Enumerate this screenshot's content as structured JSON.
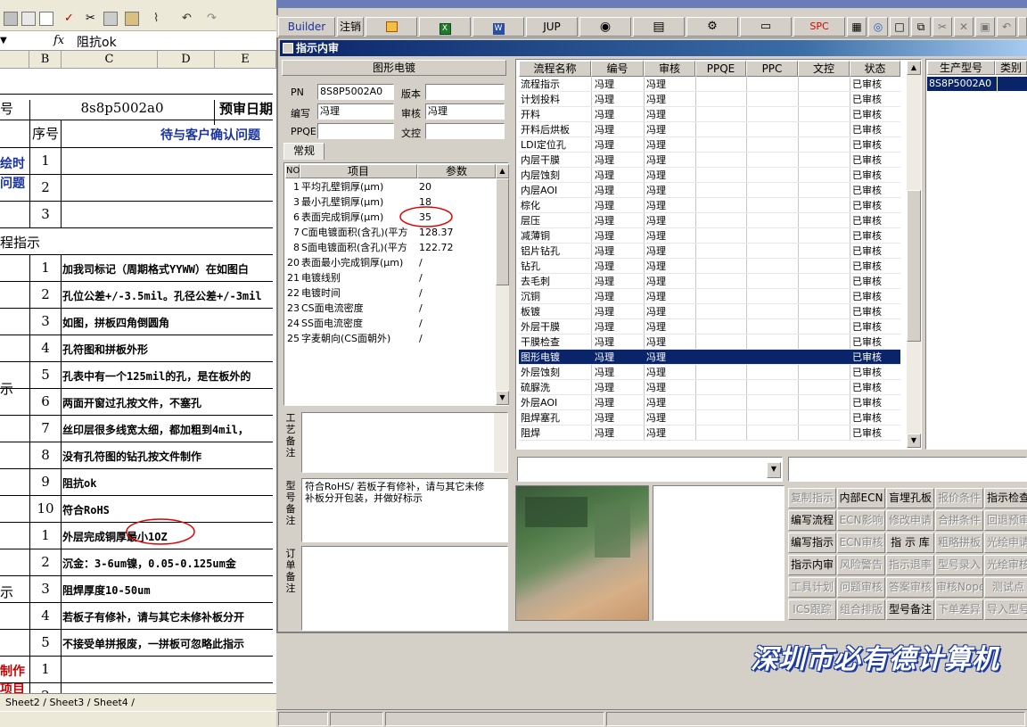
{
  "excel": {
    "formula_bar": {
      "value": "阻抗ok",
      "fx": "fx"
    },
    "columns": [
      "B",
      "C",
      "D",
      "E"
    ],
    "header_row": {
      "label": "号",
      "pn": "8s8p5002a0",
      "date_label": "预审日期"
    },
    "confirm_header": {
      "seq": "序号",
      "title": "待与客户确认问题"
    },
    "section_labels": {
      "draw_issue": "绘时问题",
      "process": "程指示",
      "left_a": "示",
      "left_b": "示",
      "make": "制作项目"
    },
    "rows_top": [
      "1",
      "2",
      "3"
    ],
    "rows_mid": [
      {
        "n": "1",
        "t": "加我司标记（周期格式YYWW）在如图白"
      },
      {
        "n": "2",
        "t": "孔位公差+/-3.5mil。孔径公差+/-3mil"
      },
      {
        "n": "3",
        "t": "如图，拼板四角倒圆角"
      },
      {
        "n": "4",
        "t": "孔符图和拼板外形"
      },
      {
        "n": "5",
        "t": "孔表中有一个125mil的孔，是在板外的"
      },
      {
        "n": "6",
        "t": "两面开窗过孔按文件，不塞孔"
      },
      {
        "n": "7",
        "t": "丝印层很多线宽太细，都加粗到4mil，"
      },
      {
        "n": "8",
        "t": "没有孔符图的钻孔按文件制作"
      },
      {
        "n": "9",
        "t": "阻抗ok"
      },
      {
        "n": "10",
        "t": "符合RoHS"
      }
    ],
    "rows_bot": [
      {
        "n": "1",
        "t": "外层完成铜厚最小1OZ"
      },
      {
        "n": "2",
        "t": "沉金：3-6um镍，0.05-0.125um金"
      },
      {
        "n": "3",
        "t": "阻焊厚度10-50um"
      },
      {
        "n": "4",
        "t": "若板子有修补，请与其它未修补板分开"
      },
      {
        "n": "5",
        "t": "不接受单拼报废，一拼板可忽略此指示"
      }
    ],
    "rows_last": [
      "1",
      "2"
    ],
    "sheet_tabs": "Sheet2 / Sheet3 / Sheet4 /"
  },
  "builder": {
    "toolbar": {
      "app_name": "Builder",
      "logout": "注销",
      "jup": "JUP",
      "spc": "SPC"
    },
    "window_title": "指示内审",
    "process_name": "图形电镀",
    "labels": {
      "pn": "PN",
      "version": "版本",
      "writer": "编写",
      "audit": "审核",
      "ppqe": "PPQE",
      "doc_ctrl": "文控",
      "tab_normal": "常规"
    },
    "values": {
      "pn": "8S8P5002A0",
      "version": "",
      "writer": "冯理",
      "audit": "冯理",
      "ppqe": "",
      "doc_ctrl": ""
    },
    "param_headers": {
      "no": "NO",
      "item": "项目",
      "param": "参数"
    },
    "params": [
      {
        "no": "1",
        "item": "平均孔壁铜厚(μm)",
        "val": "20"
      },
      {
        "no": "3",
        "item": "最小孔壁铜厚(μm)",
        "val": "18"
      },
      {
        "no": "6",
        "item": "表面完成铜厚(μm)",
        "val": "35"
      },
      {
        "no": "7",
        "item": "C面电镀面积(含孔)(平方",
        "val": "128.37"
      },
      {
        "no": "8",
        "item": "S面电镀面积(含孔)(平方",
        "val": "122.72"
      },
      {
        "no": "20",
        "item": "表面最小完成铜厚(μm)",
        "val": "/"
      },
      {
        "no": "21",
        "item": "电镀线别",
        "val": "/"
      },
      {
        "no": "22",
        "item": "电镀时间",
        "val": "/"
      },
      {
        "no": "23",
        "item": "CS面电流密度",
        "val": "/"
      },
      {
        "no": "24",
        "item": "SS面电流密度",
        "val": "/"
      },
      {
        "no": "25",
        "item": "字麦朝向(CS面朝外)",
        "val": "/"
      }
    ],
    "notes": {
      "craft_label": "工艺备注",
      "model_label": "型号备注",
      "order_label": "订单备注",
      "model_text": "符合RoHS/  若板子有修补，请与其它未修补板分开包装，并做好标示"
    },
    "flow_headers": [
      "流程名称",
      "编号",
      "审核",
      "PPQE",
      "PPC",
      "文控",
      "状态"
    ],
    "flows": [
      {
        "name": "流程指示",
        "w": "冯理",
        "a": "冯理",
        "s": "已审核"
      },
      {
        "name": "计划投料",
        "w": "冯理",
        "a": "冯理",
        "s": "已审核"
      },
      {
        "name": "开料",
        "w": "冯理",
        "a": "冯理",
        "s": "已审核"
      },
      {
        "name": "开料后烘板",
        "w": "冯理",
        "a": "冯理",
        "s": "已审核"
      },
      {
        "name": "LDI定位孔",
        "w": "冯理",
        "a": "冯理",
        "s": "已审核"
      },
      {
        "name": "内层干膜",
        "w": "冯理",
        "a": "冯理",
        "s": "已审核"
      },
      {
        "name": "内层蚀刻",
        "w": "冯理",
        "a": "冯理",
        "s": "已审核"
      },
      {
        "name": "内层AOI",
        "w": "冯理",
        "a": "冯理",
        "s": "已审核"
      },
      {
        "name": "棕化",
        "w": "冯理",
        "a": "冯理",
        "s": "已审核"
      },
      {
        "name": "层压",
        "w": "冯理",
        "a": "冯理",
        "s": "已审核"
      },
      {
        "name": "减薄铜",
        "w": "冯理",
        "a": "冯理",
        "s": "已审核"
      },
      {
        "name": "铝片钻孔",
        "w": "冯理",
        "a": "冯理",
        "s": "已审核"
      },
      {
        "name": "钻孔",
        "w": "冯理",
        "a": "冯理",
        "s": "已审核"
      },
      {
        "name": "去毛刺",
        "w": "冯理",
        "a": "冯理",
        "s": "已审核"
      },
      {
        "name": "沉铜",
        "w": "冯理",
        "a": "冯理",
        "s": "已审核"
      },
      {
        "name": "板镀",
        "w": "冯理",
        "a": "冯理",
        "s": "已审核"
      },
      {
        "name": "外层干膜",
        "w": "冯理",
        "a": "冯理",
        "s": "已审核"
      },
      {
        "name": "干膜检查",
        "w": "冯理",
        "a": "冯理",
        "s": "已审核"
      },
      {
        "name": "图形电镀",
        "w": "冯理",
        "a": "冯理",
        "s": "已审核"
      },
      {
        "name": "外层蚀刻",
        "w": "冯理",
        "a": "冯理",
        "s": "已审核"
      },
      {
        "name": "硫脲洗",
        "w": "冯理",
        "a": "冯理",
        "s": "已审核"
      },
      {
        "name": "外层AOI",
        "w": "冯理",
        "a": "冯理",
        "s": "已审核"
      },
      {
        "name": "阻焊塞孔",
        "w": "冯理",
        "a": "冯理",
        "s": "已审核"
      },
      {
        "name": "阻焊",
        "w": "冯理",
        "a": "冯理",
        "s": "已审核"
      }
    ],
    "model_headers": [
      "生产型号",
      "类别"
    ],
    "models": [
      {
        "pn": "8S8P5002A0",
        "type": ""
      }
    ],
    "buttons": [
      [
        {
          "t": "复制指示",
          "d": true
        },
        {
          "t": "内部ECN",
          "d": false
        },
        {
          "t": "盲埋孔板",
          "d": false
        },
        {
          "t": "报价条件",
          "d": true
        },
        {
          "t": "指示检查",
          "d": false
        }
      ],
      [
        {
          "t": "编写流程",
          "d": false
        },
        {
          "t": "ECN影响",
          "d": true
        },
        {
          "t": "修改申请",
          "d": true
        },
        {
          "t": "合拼条件",
          "d": true
        },
        {
          "t": "回退预审",
          "d": true
        }
      ],
      [
        {
          "t": "编写指示",
          "d": false
        },
        {
          "t": "ECN审核",
          "d": true
        },
        {
          "t": "指 示 库",
          "d": false
        },
        {
          "t": "粗略拼板",
          "d": true
        },
        {
          "t": "光绘申请",
          "d": true
        }
      ],
      [
        {
          "t": "指示内审",
          "d": false
        },
        {
          "t": "风险警告",
          "d": true
        },
        {
          "t": "指示退率",
          "d": true
        },
        {
          "t": "型号录入",
          "d": true
        },
        {
          "t": "光绘审核",
          "d": true
        }
      ],
      [
        {
          "t": "工具计划",
          "d": true
        },
        {
          "t": "问题审核",
          "d": true
        },
        {
          "t": "答案审核",
          "d": true
        },
        {
          "t": "审核Nope",
          "d": true
        },
        {
          "t": "测试点",
          "d": true
        }
      ],
      [
        {
          "t": "ICS跟踪",
          "d": true
        },
        {
          "t": "组合排版",
          "d": true
        },
        {
          "t": "型号备注",
          "d": false
        },
        {
          "t": "下单差异",
          "d": true
        },
        {
          "t": "导入型号",
          "d": true
        }
      ]
    ],
    "company_banner": "深圳市必有德计算机"
  }
}
